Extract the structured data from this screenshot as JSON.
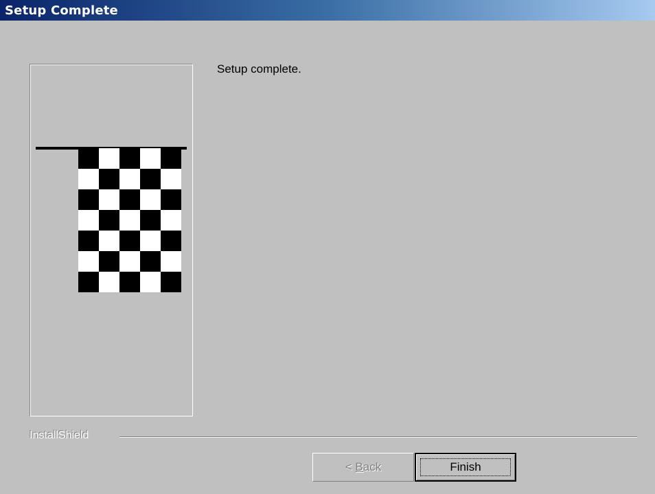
{
  "window": {
    "title": "Setup Complete"
  },
  "main": {
    "message": "Setup complete."
  },
  "image_panel": {
    "icon": "checkered-flag-icon"
  },
  "footer": {
    "brand": "InstallShield"
  },
  "buttons": {
    "back": {
      "prefix": "< ",
      "accel": "B",
      "rest": "ack",
      "enabled": false
    },
    "finish": {
      "label": "Finish",
      "default": true
    }
  },
  "colors": {
    "face": "#c0c0c0",
    "title_start": "#0a246a",
    "title_end": "#a6caf0"
  }
}
